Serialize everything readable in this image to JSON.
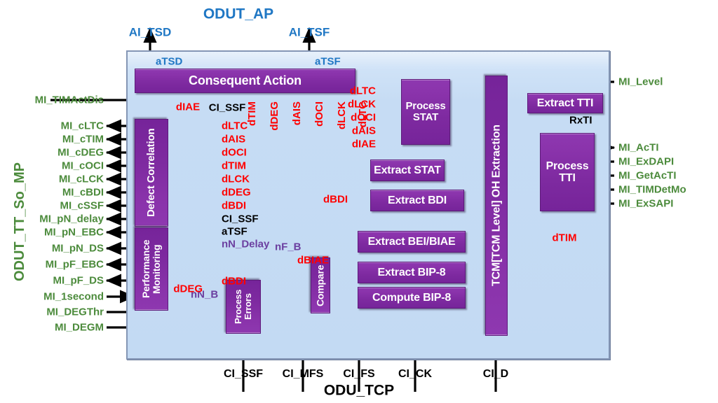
{
  "diagram": {
    "top_title": "ODUT_AP",
    "bottom_title": "ODU_TCP",
    "left_title": "ODUT_TT_So_MP"
  },
  "colors": {
    "panel_fill": "#c6dcf4",
    "box_fill": "#7e2aa0",
    "blue_text": "#1f77c4",
    "red_text": "#ff0000",
    "green_text": "#4c8b3c",
    "purple_text": "#6b3fa0",
    "black_text": "#000000"
  },
  "boxes": {
    "consequent_action": "Consequent Action",
    "defect_correlation": "Defect Correlation",
    "performance_monitoring": "Performance Monitoring",
    "process_errors": "Process Errors",
    "compare": "Compare",
    "process_stat": "Process STAT",
    "extract_stat": "Extract STAT",
    "extract_bdi": "Extract BDI",
    "extract_bei_biae": "Extract BEI/BIAE",
    "extract_bip8": "Extract BIP-8",
    "compute_bip8": "Compute BIP-8",
    "tcm_oh_extraction": "TCM[TCM Level] OH Extraction",
    "extract_tti": "Extract TTI",
    "process_tti": "Process TTI"
  },
  "top_signals": [
    {
      "name": "AI_TSD",
      "color": "blue"
    },
    {
      "name": "AI_TSF",
      "color": "blue"
    }
  ],
  "inner_top_signals": [
    {
      "name": "aTSD",
      "color": "blue"
    },
    {
      "name": "aTSF",
      "color": "blue"
    }
  ],
  "consequent_action_inputs": [
    {
      "name": "dIAE",
      "color": "red"
    },
    {
      "name": "CI_SSF",
      "color": "black"
    },
    {
      "name": "dTIM",
      "color": "red"
    },
    {
      "name": "dDEG",
      "color": "red"
    },
    {
      "name": "dAIS",
      "color": "red"
    },
    {
      "name": "dOCI",
      "color": "red"
    },
    {
      "name": "dLCK",
      "color": "red"
    },
    {
      "name": "dLTC",
      "color": "red"
    }
  ],
  "defect_correlation_inputs": [
    {
      "name": "dLTC",
      "color": "red"
    },
    {
      "name": "dAIS",
      "color": "red"
    },
    {
      "name": "dOCI",
      "color": "red"
    },
    {
      "name": "dTIM",
      "color": "red"
    },
    {
      "name": "dLCK",
      "color": "red"
    },
    {
      "name": "dDEG",
      "color": "red"
    },
    {
      "name": "dBDI",
      "color": "red"
    },
    {
      "name": "CI_SSF",
      "color": "black"
    }
  ],
  "performance_monitoring_inputs": [
    {
      "name": "aTSF",
      "color": "black"
    },
    {
      "name": "nN_Delay",
      "color": "purple"
    },
    {
      "name": "nF_B",
      "color": "purple"
    },
    {
      "name": "dBIAE",
      "color": "red"
    },
    {
      "name": "dBDI",
      "color": "red"
    },
    {
      "name": "nN_B",
      "color": "purple"
    }
  ],
  "left_signals": [
    {
      "name": "MI_TIMActDis",
      "color": "green",
      "dir": "in"
    },
    {
      "name": "MI_cLTC",
      "color": "green",
      "dir": "out"
    },
    {
      "name": "MI_cTIM",
      "color": "green",
      "dir": "out"
    },
    {
      "name": "MI_cDEG",
      "color": "green",
      "dir": "out"
    },
    {
      "name": "MI_cOCI",
      "color": "green",
      "dir": "out"
    },
    {
      "name": "MI_cLCK",
      "color": "green",
      "dir": "out"
    },
    {
      "name": "MI_cBDI",
      "color": "green",
      "dir": "out"
    },
    {
      "name": "MI_cSSF",
      "color": "green",
      "dir": "out"
    },
    {
      "name": "MI_pN_delay",
      "color": "green",
      "dir": "out"
    },
    {
      "name": "MI_pN_EBC",
      "color": "green",
      "dir": "out"
    },
    {
      "name": "MI_pN_DS",
      "color": "green",
      "dir": "out"
    },
    {
      "name": "MI_pF_EBC",
      "color": "green",
      "dir": "out"
    },
    {
      "name": "MI_pF_DS",
      "color": "green",
      "dir": "out"
    },
    {
      "name": "MI_1second",
      "color": "green",
      "dir": "in"
    },
    {
      "name": "MI_DEGThr",
      "color": "green",
      "dir": "in"
    },
    {
      "name": "MI_DEGM",
      "color": "green",
      "dir": "in"
    }
  ],
  "right_signals": [
    {
      "name": "MI_Level",
      "color": "green",
      "dir": "in"
    },
    {
      "name": "MI_AcTI",
      "color": "green",
      "dir": "out"
    },
    {
      "name": "MI_ExDAPI",
      "color": "green",
      "dir": "in"
    },
    {
      "name": "MI_GetAcTI",
      "color": "green",
      "dir": "in"
    },
    {
      "name": "MI_TIMDetMo",
      "color": "green",
      "dir": "in"
    },
    {
      "name": "MI_ExSAPI",
      "color": "green",
      "dir": "in"
    }
  ],
  "process_stat_outputs": [
    {
      "name": "dLTC",
      "color": "red"
    },
    {
      "name": "dLCK",
      "color": "red"
    },
    {
      "name": "dOCI",
      "color": "red"
    },
    {
      "name": "dAIS",
      "color": "red"
    },
    {
      "name": "dIAE",
      "color": "red"
    }
  ],
  "misc_labels": [
    {
      "name": "dBDI",
      "color": "red"
    },
    {
      "name": "dDEG",
      "color": "red"
    },
    {
      "name": "RxTI",
      "color": "black"
    },
    {
      "name": "dTIM",
      "color": "red"
    }
  ],
  "bottom_signals": [
    {
      "name": "CI_SSF",
      "color": "black"
    },
    {
      "name": "CI_MFS",
      "color": "black"
    },
    {
      "name": "CI_FS",
      "color": "black"
    },
    {
      "name": "CI_CK",
      "color": "black"
    },
    {
      "name": "CI_D",
      "color": "black"
    }
  ]
}
